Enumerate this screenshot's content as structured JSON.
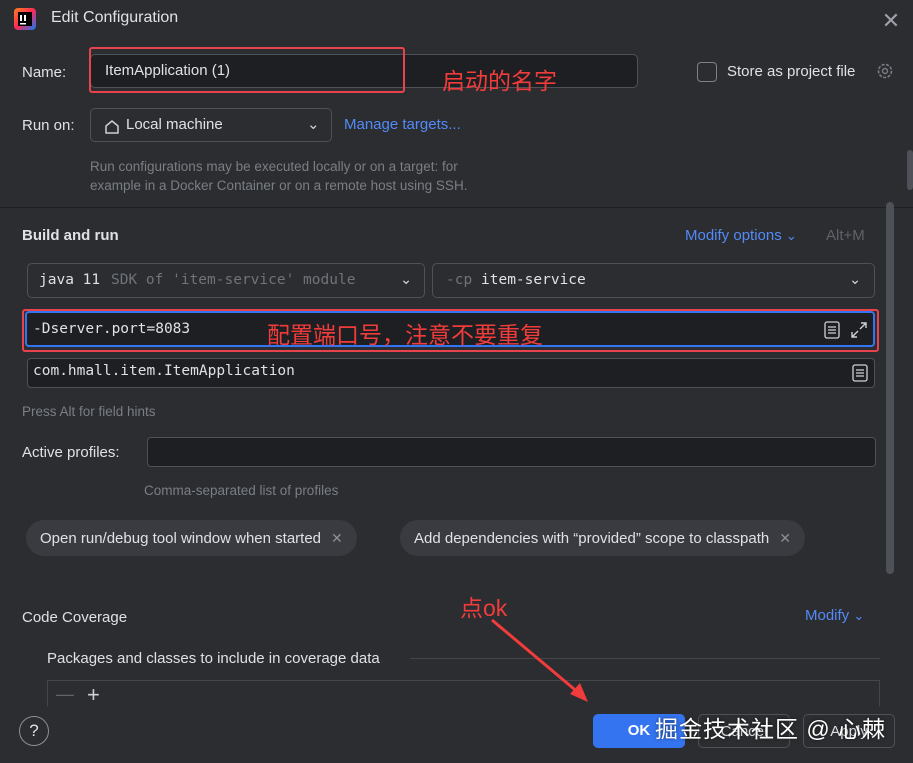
{
  "window": {
    "title": "Edit Configuration",
    "close_icon": "close-icon"
  },
  "name": {
    "label": "Name:",
    "value": "ItemApplication (1)",
    "annotation": "启动的名字"
  },
  "store_as_project_file": {
    "label": "Store as project file",
    "checked": false
  },
  "run_on": {
    "label": "Run on:",
    "value": "Local machine",
    "manage_link": "Manage targets...",
    "hint_line1": "Run configurations may be executed locally or on a target: for",
    "hint_line2": "example in a Docker Container or on a remote host using SSH."
  },
  "build_and_run": {
    "title": "Build and run",
    "modify_options": "Modify options",
    "shortcut": "Alt+M",
    "sdk_java": "java 11",
    "sdk_rest": "SDK of 'item-service' module",
    "cp_prefix": "-cp",
    "cp_value": "item-service",
    "vm_options": "-Dserver.port=8083",
    "vm_annotation": "配置端口号，注意不要重复",
    "main_class": "com.hmall.item.ItemApplication",
    "field_hint": "Press Alt for field hints"
  },
  "active_profiles": {
    "label": "Active profiles:",
    "value": "",
    "hint": "Comma-separated list of profiles"
  },
  "chips": [
    {
      "label": "Open run/debug tool window when started"
    },
    {
      "label": "Add dependencies with “provided” scope to classpath"
    }
  ],
  "code_coverage": {
    "title": "Code Coverage",
    "modify": "Modify",
    "packages_label": "Packages and classes to include in coverage data",
    "ok_annotation": "点ok"
  },
  "footer": {
    "help": "?",
    "ok": "OK",
    "cancel": "Cancel",
    "apply": "Apply",
    "watermark": "掘金技术社区 @ 心棘"
  },
  "colors": {
    "accent": "#3574f0",
    "annotation": "#f23c3c",
    "link": "#548af7",
    "background": "#2b2d30"
  }
}
